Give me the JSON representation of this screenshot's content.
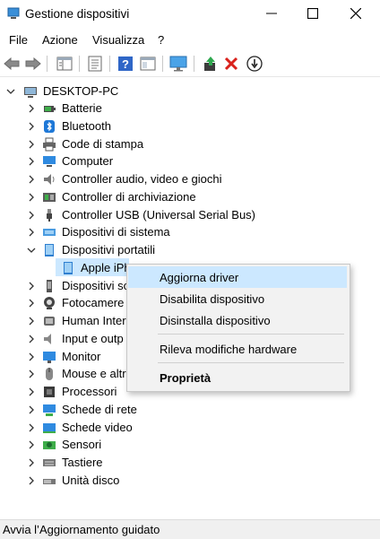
{
  "window": {
    "title": "Gestione dispositivi",
    "icons": {
      "app": "device-manager-icon",
      "minimize": "minimize-icon",
      "maximize": "maximize-icon",
      "close": "close-icon"
    }
  },
  "menu": [
    "File",
    "Azione",
    "Visualizza",
    "?"
  ],
  "toolbar": {
    "buttons": [
      "back-arrow-icon",
      "forward-arrow-icon",
      "properties-grid-icon",
      "device-list-icon",
      "help-icon",
      "console-view-icon",
      "monitor-scan-icon",
      "update-driver-icon",
      "uninstall-x-icon",
      "disable-device-icon"
    ]
  },
  "tree": {
    "root": "DESKTOP-PC",
    "items": [
      {
        "label": "Batterie",
        "icon": "battery-icon"
      },
      {
        "label": "Bluetooth",
        "icon": "bluetooth-icon"
      },
      {
        "label": "Code di stampa",
        "icon": "printer-icon"
      },
      {
        "label": "Computer",
        "icon": "computer-icon"
      },
      {
        "label": "Controller audio, video e giochi",
        "icon": "speaker-icon"
      },
      {
        "label": "Controller di archiviazione",
        "icon": "storage-controller-icon"
      },
      {
        "label": "Controller USB (Universal Serial Bus)",
        "icon": "usb-icon"
      },
      {
        "label": "Dispositivi di sistema",
        "icon": "system-device-icon"
      },
      {
        "label": "Dispositivi portatili",
        "icon": "portable-device-icon",
        "expanded": true
      },
      {
        "label": "Apple iPh",
        "icon": "phone-icon",
        "child": true,
        "selected": true
      },
      {
        "label": "Dispositivi so",
        "icon": "software-device-icon"
      },
      {
        "label": "Fotocamere",
        "icon": "camera-icon"
      },
      {
        "label": "Human Inter",
        "icon": "hid-icon"
      },
      {
        "label": "Input e outp",
        "icon": "audio-io-icon"
      },
      {
        "label": "Monitor",
        "icon": "monitor-icon"
      },
      {
        "label": "Mouse e altr",
        "icon": "mouse-icon"
      },
      {
        "label": "Processori",
        "icon": "processor-icon"
      },
      {
        "label": "Schede di rete",
        "icon": "network-adapter-icon"
      },
      {
        "label": "Schede video",
        "icon": "display-adapter-icon"
      },
      {
        "label": "Sensori",
        "icon": "sensor-icon"
      },
      {
        "label": "Tastiere",
        "icon": "keyboard-icon"
      },
      {
        "label": "Unità disco",
        "icon": "disk-drive-icon"
      }
    ]
  },
  "context_menu": {
    "items": [
      "Aggiorna driver",
      "Disabilita dispositivo",
      "Disinstalla dispositivo",
      "Rileva modifiche hardware",
      "Proprietà"
    ],
    "highlighted": "Aggiorna driver"
  },
  "status": "Avvia l’Aggiornamento guidato"
}
